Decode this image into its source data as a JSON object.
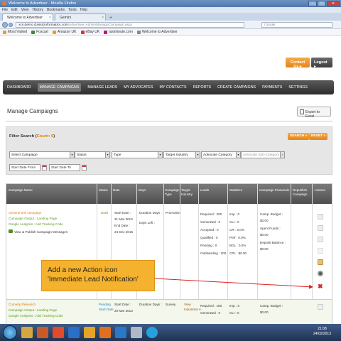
{
  "browser": {
    "window_title": "Welcome to Advertiser - Mozilla Firefox",
    "menu": [
      "File",
      "Edit",
      "View",
      "History",
      "Bookmarks",
      "Tools",
      "Help"
    ],
    "tabs": [
      {
        "label": "Welcome to Advertiser",
        "active": true
      },
      {
        "label": "Gemini",
        "active": false
      }
    ],
    "url_domain": "xcs.demo.classicinformatics.com",
    "url_path": "/Advertiser-Admin/ManageCampaign.aspx",
    "search_placeholder": "Google",
    "bookmarks": [
      {
        "label": "Most Visited",
        "icon": "star-icon",
        "color": "#e0a030"
      },
      {
        "label": "Foxcart",
        "icon": "foxcart-icon",
        "color": "#3a8a3a"
      },
      {
        "label": "Amazon UK",
        "icon": "amazon-icon",
        "color": "#f29a1d"
      },
      {
        "label": "eBay UK",
        "icon": "ebay-icon",
        "color": "#d33"
      },
      {
        "label": "lastminute.com",
        "icon": "lastminute-icon",
        "color": "#c0167a"
      },
      {
        "label": "Welcome to Advertiser",
        "icon": "page-icon",
        "color": "#888"
      }
    ]
  },
  "header": {
    "contact_label": "Contact Us",
    "logout_label": "Logout"
  },
  "nav": [
    "DASHBOARD",
    "MANAGE CAMPAIGNS",
    "MANAGE LEADS",
    "MY ADVOCATES",
    "MY CONTACTS",
    "REPORTS",
    "CREATE CAMPAIGNS",
    "PAYMENTS",
    "SETTINGS"
  ],
  "nav_active": "MANAGE CAMPAIGNS",
  "page": {
    "title": "Manage Campaigns",
    "export_label": "Export to Excel"
  },
  "filter": {
    "title_prefix": "Filter Search (",
    "count_label": "Count: 6",
    "title_suffix": ")",
    "search_label": "SEARCH",
    "reset_label": "RESET",
    "select_campaign": "Select Campaign",
    "status": "Status",
    "type": "Type",
    "target_industry": "Target Industry",
    "advocate_category": "Advocate Category",
    "advocate_subcategory": "Advocate Sub-Category",
    "start_date_from": "Start Date From",
    "start_date_to": "Start Date To"
  },
  "table": {
    "headers": {
      "campaign_name": "Campaign Name",
      "status": "Status",
      "date": "Date",
      "days": "Days",
      "campaign_type": "Campaign Type",
      "target_industry": "Target Industry",
      "leads": "Leads",
      "statistics": "Statistics",
      "financials": "Campaign Financials",
      "republish": "Republish Campaign",
      "actions": "Actions"
    },
    "row1": {
      "name": "General test campaign",
      "output": "Campaign Output : Landing Page",
      "analytics": "Google Analytics : Add Tracking Code",
      "publish": "View & Publish Campaign Messages",
      "status": "Draft",
      "start": "Start Date :",
      "start_val": "31 Mar 2013",
      "end": "End Date :",
      "end_val": "24 Dec 2015",
      "duration": "Duration Days :",
      "days_left": "Days Left :",
      "type": "Promotion",
      "leads": [
        "Required : 200",
        "Generated : 0",
        "Accepted : 0",
        "Qualified : 0",
        "Pending : 0",
        "Outstanding : 200"
      ],
      "stats": [
        "Imp : 0",
        "CLI : 0",
        "CR : 0.0%",
        "Perf : 0.0%",
        "BGL : 0.0%",
        "CPL : $0.00"
      ],
      "fin": [
        "Camp. Budget :",
        "$0.00",
        "Spent Funds :",
        "$0.00",
        "Deposit Balance :",
        "$0.00"
      ]
    },
    "row2": {
      "name": "Comedy Research",
      "output": "Campaign Output : Landing Page",
      "analytics": "Google Analytics : Add Tracking Code",
      "status_1": "Pending",
      "status_2": "Start Date",
      "start": "Start Date :",
      "start_val": "20 Mar 2013",
      "duration": "Duration Days :",
      "type": "Survey",
      "industry_1": "View",
      "industry_2": "Industries ▾",
      "leads": [
        "Required : 100",
        "Generated : 0"
      ],
      "stats": [
        "Imp : 0",
        "CLI : 0"
      ],
      "fin": [
        "Camp. Budget :",
        "$0.00"
      ]
    }
  },
  "annotation": {
    "line1": "Add a new Action icon",
    "line2": "'Immediate Lead Notification'",
    "color": "#f5b22e"
  },
  "taskbar": {
    "time": "21:08",
    "date": "24/02/2013"
  }
}
